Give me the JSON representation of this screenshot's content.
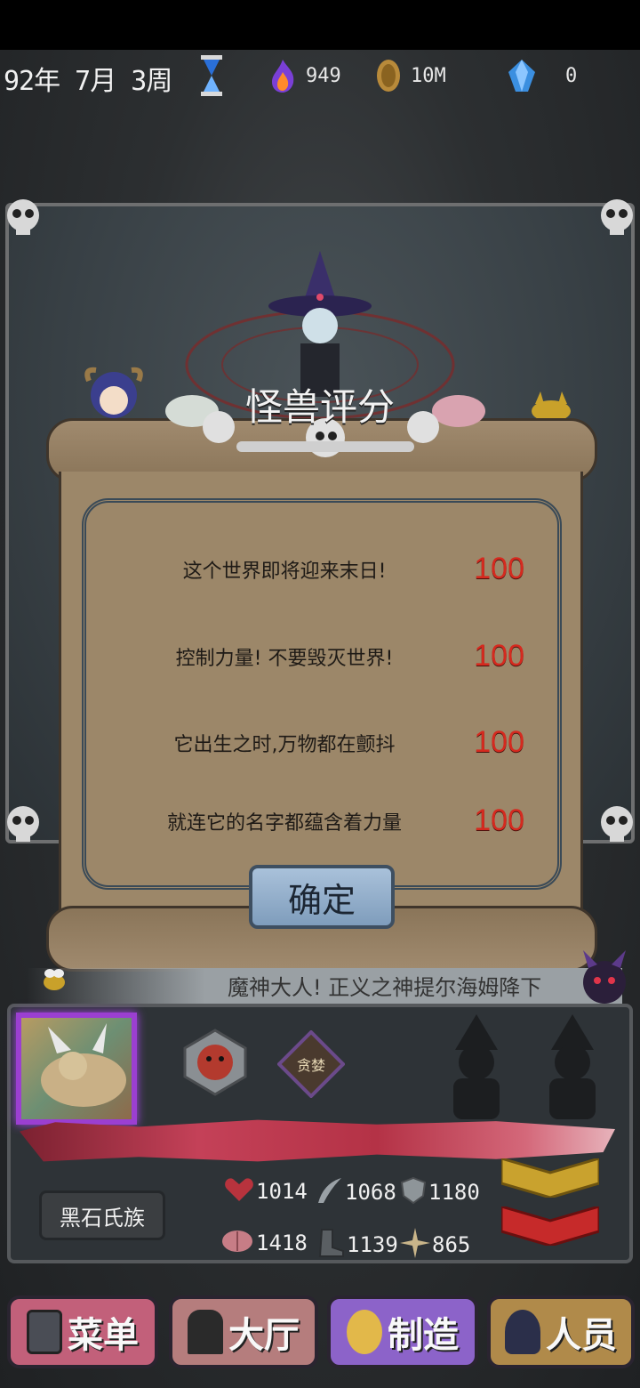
{
  "header": {
    "date": "92年 7月 3周",
    "resources": [
      {
        "icon": "flame-icon",
        "value": "949"
      },
      {
        "icon": "coin-icon",
        "value": "10M"
      },
      {
        "icon": "crystal-icon",
        "value": "0"
      }
    ]
  },
  "panel": {
    "title": "怪兽评分",
    "scores": [
      {
        "label": "这个世界即将迎来末日!",
        "value": "100"
      },
      {
        "label": "控制力量! 不要毁灭世界!",
        "value": "100"
      },
      {
        "label": "它出生之时,万物都在颤抖",
        "value": "100"
      },
      {
        "label": "就连它的名字都蕴含着力量",
        "value": "100"
      }
    ],
    "confirm_label": "确定"
  },
  "ticker": {
    "text": "魔神大人! 正义之神提尔海姆降下"
  },
  "monster": {
    "badge_text": "贪婪",
    "clan": "黑石氏族",
    "stats_row1": [
      {
        "icon": "heart-icon",
        "value": "1014"
      },
      {
        "icon": "claw-icon",
        "value": "1068"
      },
      {
        "icon": "shield-icon",
        "value": "1180"
      }
    ],
    "stats_row2": [
      {
        "icon": "brain-icon",
        "value": "1418"
      },
      {
        "icon": "boot-icon",
        "value": "1139"
      },
      {
        "icon": "sparkle-icon",
        "value": "865"
      }
    ]
  },
  "nav": {
    "items": [
      {
        "label": "菜单",
        "icon": "menu-book-icon",
        "color": "#c2607a"
      },
      {
        "label": "大厅",
        "icon": "door-icon",
        "color": "#b57d7d"
      },
      {
        "label": "制造",
        "icon": "paw-icon",
        "color": "#8c63c9"
      },
      {
        "label": "人员",
        "icon": "person-icon",
        "color": "#b08a4a"
      }
    ]
  }
}
